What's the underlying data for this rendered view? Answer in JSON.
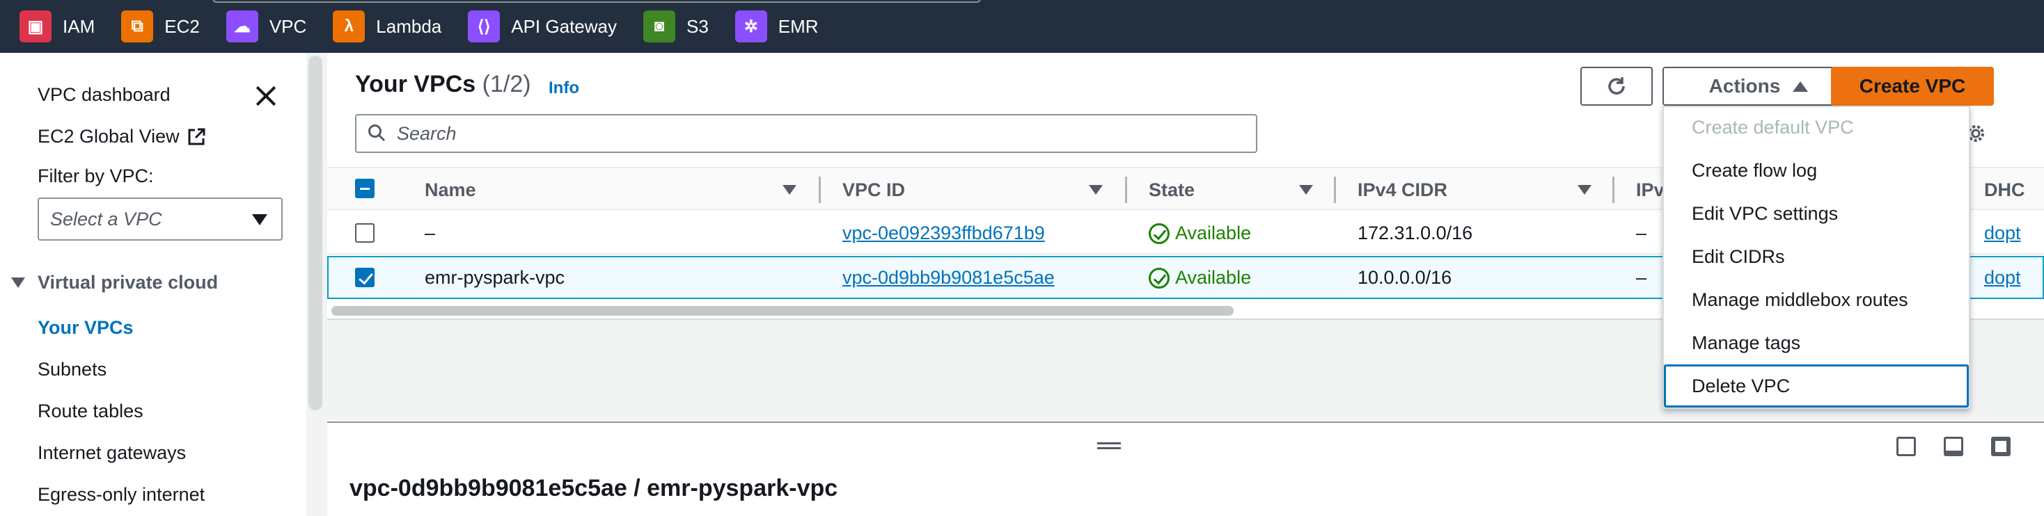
{
  "favorites": [
    {
      "label": "IAM",
      "icon": "iam-icon",
      "color": "#dd344c"
    },
    {
      "label": "EC2",
      "icon": "ec2-icon",
      "color": "#ed7100"
    },
    {
      "label": "VPC",
      "icon": "vpc-icon",
      "color": "#8c4fff"
    },
    {
      "label": "Lambda",
      "icon": "lambda-icon",
      "color": "#ed7100"
    },
    {
      "label": "API Gateway",
      "icon": "api-gateway-icon",
      "color": "#8c4fff"
    },
    {
      "label": "S3",
      "icon": "s3-icon",
      "color": "#3f8624"
    },
    {
      "label": "EMR",
      "icon": "emr-icon",
      "color": "#8c4fff"
    }
  ],
  "sidebar": {
    "dashboard": "VPC dashboard",
    "ec2_global_view": "EC2 Global View",
    "filter_label": "Filter by VPC:",
    "filter_placeholder": "Select a VPC",
    "section": "Virtual private cloud",
    "items": [
      "Your VPCs",
      "Subnets",
      "Route tables",
      "Internet gateways",
      "Egress-only internet"
    ]
  },
  "main": {
    "title": "Your VPCs",
    "count": "(1/2)",
    "info": "Info",
    "search_placeholder": "Search",
    "actions_label": "Actions",
    "create_label": "Create VPC"
  },
  "table": {
    "columns": [
      "Name",
      "VPC ID",
      "State",
      "IPv4 CIDR",
      "IPv",
      "DHC"
    ],
    "rows": [
      {
        "name": "–",
        "vpc_id": "vpc-0e092393ffbd671b9",
        "state": "Available",
        "cidr": "172.31.0.0/16",
        "ipv6": "–",
        "dhcp": "dopt",
        "selected": false
      },
      {
        "name": "emr-pyspark-vpc",
        "vpc_id": "vpc-0d9bb9b9081e5c5ae",
        "state": "Available",
        "cidr": "10.0.0.0/16",
        "ipv6": "–",
        "dhcp": "dopt",
        "selected": true
      }
    ]
  },
  "split_panel": {
    "title": "vpc-0d9bb9b9081e5c5ae / emr-pyspark-vpc"
  },
  "actions_menu": {
    "items": [
      {
        "label": "Create default VPC",
        "disabled": true
      },
      {
        "label": "Create flow log",
        "disabled": false
      },
      {
        "label": "Edit VPC settings",
        "disabled": false
      },
      {
        "label": "Edit CIDRs",
        "disabled": false
      },
      {
        "label": "Manage middlebox routes",
        "disabled": false
      },
      {
        "label": "Manage tags",
        "disabled": false
      },
      {
        "label": "Delete VPC",
        "disabled": false,
        "focused": true
      }
    ]
  },
  "colors": {
    "header": "#232f3e",
    "primary": "#ec7211",
    "link": "#0073bb",
    "success": "#1d8102"
  }
}
